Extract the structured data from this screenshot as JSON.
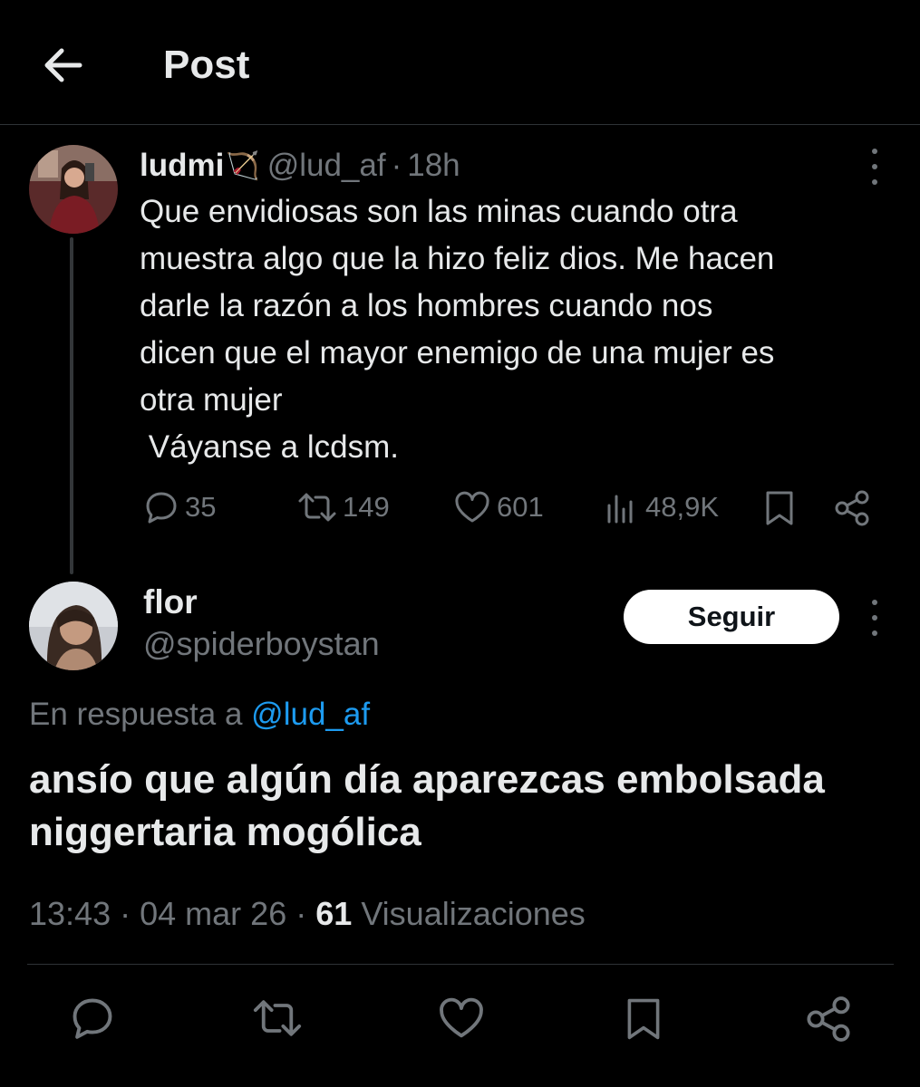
{
  "header": {
    "title": "Post"
  },
  "original_post": {
    "display_name": "ludmi",
    "emoji": "🏹",
    "handle": "@lud_af",
    "separator": "·",
    "time": "18h",
    "text": "Que envidiosas son las minas cuando otra\nmuestra algo que la hizo feliz dios. Me hacen\ndarle la razón a los hombres cuando nos\ndicen que el mayor enemigo de una mujer es\notra mujer\n Váyanse a lcdsm.",
    "stats": {
      "replies": "35",
      "reposts": "149",
      "likes": "601",
      "views": "48,9K"
    }
  },
  "reply_post": {
    "display_name": "flor",
    "handle": "@spiderboystan",
    "follow_label": "Seguir",
    "replying_to_prefix": "En respuesta a",
    "replying_to_handle": "@lud_af",
    "text": "ansío que algún día aparezcas embolsada\nniggertaria mogólica",
    "time": "13:43",
    "date": "04 mar 26",
    "separator": "·",
    "views_count": "61",
    "views_label": "Visualizaciones"
  },
  "colors": {
    "background": "#000000",
    "text": "#e7e9ea",
    "muted": "#71767b",
    "link": "#1d9bf0",
    "divider": "#2f3336"
  },
  "icons": [
    "back-arrow-icon",
    "more-icon",
    "reply-icon",
    "repost-icon",
    "like-icon",
    "views-icon",
    "bookmark-icon",
    "share-icon"
  ]
}
